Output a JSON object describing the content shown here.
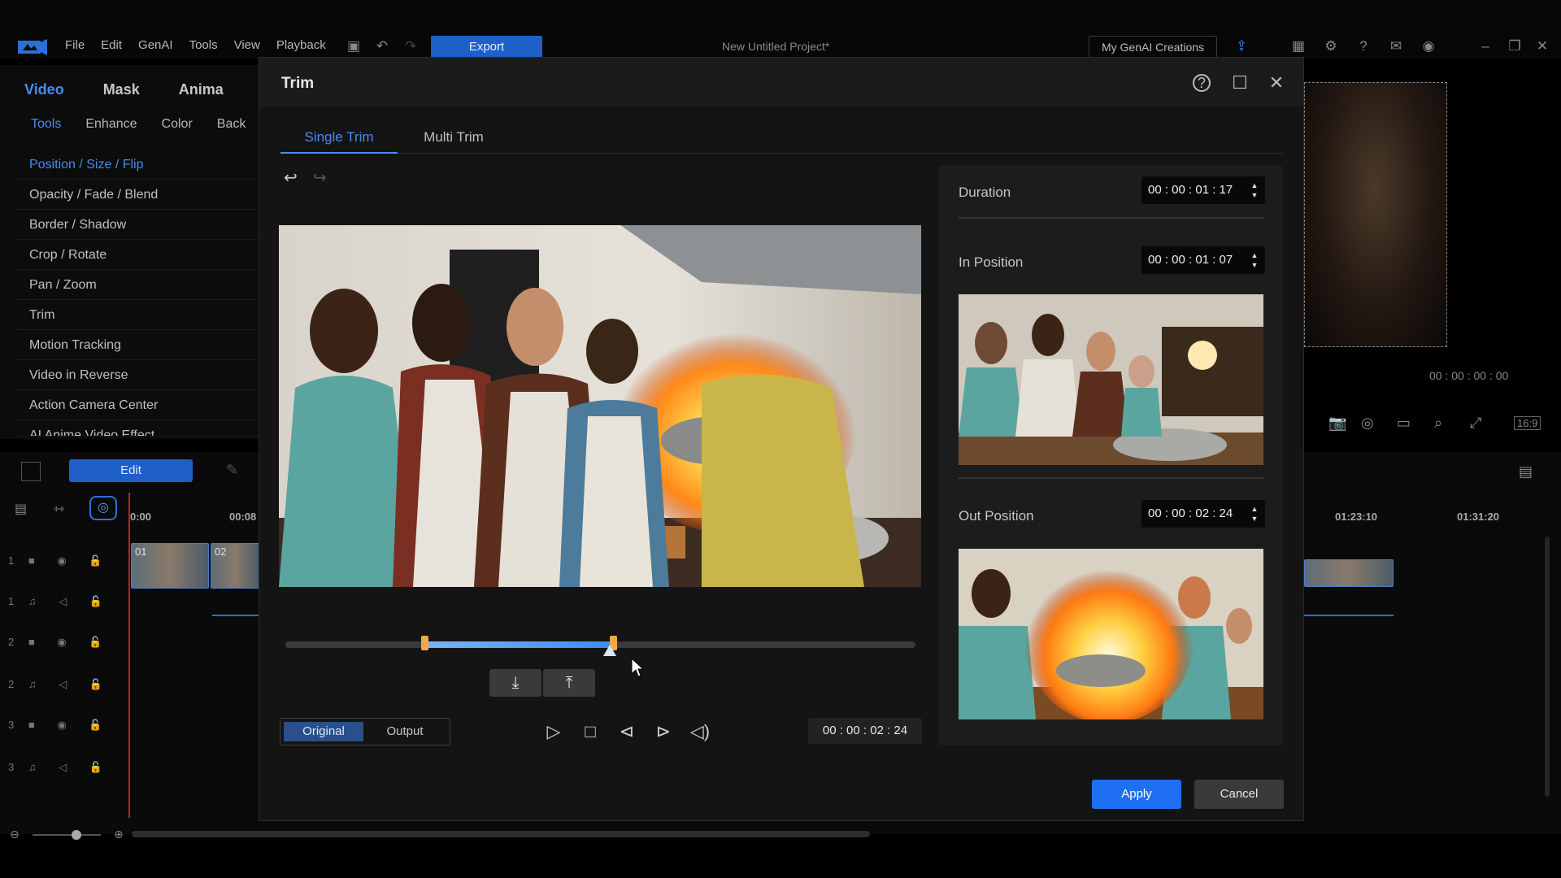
{
  "menubar": {
    "items": [
      "File",
      "Edit",
      "GenAI",
      "Tools",
      "View",
      "Playback"
    ],
    "export_label": "Export",
    "project_title": "New Untitled Project*",
    "genai_label": "My GenAI Creations"
  },
  "left_panel": {
    "main_tabs": [
      "Video",
      "Mask",
      "Anima"
    ],
    "sub_tabs": [
      "Tools",
      "Enhance",
      "Color",
      "Back"
    ],
    "tools": [
      "Position / Size / Flip",
      "Opacity / Fade / Blend",
      "Border / Shadow",
      "Crop / Rotate",
      "Pan / Zoom",
      "Trim",
      "Motion Tracking",
      "Video in Reverse",
      "Action Camera Center",
      "AI Anime Video Effect"
    ]
  },
  "timeline": {
    "edit_label": "Edit",
    "ruler": [
      "0:00",
      "00:08",
      "01:23:10",
      "01:31:20"
    ],
    "tracks": [
      "1",
      "1",
      "2",
      "2",
      "3",
      "3"
    ],
    "clips": [
      "01",
      "02"
    ]
  },
  "preview": {
    "timecode": "00 : 00 : 00 : 00"
  },
  "dialog": {
    "title": "Trim",
    "tabs": [
      "Single Trim",
      "Multi Trim"
    ],
    "view_original": "Original",
    "view_output": "Output",
    "current_time": "00 : 00 : 02 : 24",
    "duration_label": "Duration",
    "duration_value": "00 : 00 : 01 : 17",
    "in_label": "In Position",
    "in_value": "00 : 00 : 01 : 07",
    "out_label": "Out Position",
    "out_value": "00 : 00 : 02 : 24",
    "apply_label": "Apply",
    "cancel_label": "Cancel",
    "trim_range": {
      "in_fraction": 0.22,
      "out_fraction": 0.52,
      "playhead_fraction": 0.515
    }
  }
}
